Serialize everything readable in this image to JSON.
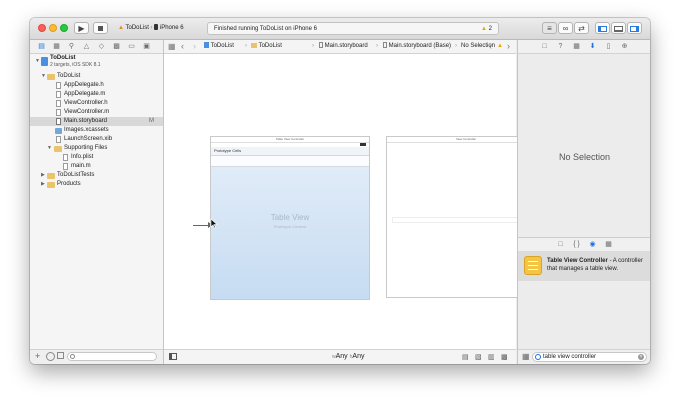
{
  "toolbar": {
    "scheme_app": "ToDoList",
    "scheme_device": "iPhone 6",
    "activity_status": "Finished running ToDoList on iPhone 6",
    "warning_count": "2"
  },
  "navigator": {
    "project_name": "ToDoList",
    "project_subtitle": "2 targets, iOS SDK 8.1",
    "items": [
      {
        "label": "ToDoList"
      },
      {
        "label": "AppDelegate.h"
      },
      {
        "label": "AppDelegate.m"
      },
      {
        "label": "ViewController.h"
      },
      {
        "label": "ViewController.m"
      },
      {
        "label": "Main.storyboard",
        "badge": "M"
      },
      {
        "label": "Images.xcassets"
      },
      {
        "label": "LaunchScreen.xib"
      },
      {
        "label": "Supporting Files"
      },
      {
        "label": "Info.plist"
      },
      {
        "label": "main.m"
      },
      {
        "label": "ToDoListTests"
      },
      {
        "label": "Products"
      }
    ]
  },
  "jumpbar": {
    "crumbs": [
      "ToDoList",
      "ToDoList",
      "Main.storyboard",
      "Main.storyboard (Base)",
      "No Selection"
    ]
  },
  "canvas": {
    "scene1_title": "Table View Controller",
    "prototype_cells": "Prototype Cells",
    "table_view_label": "Table View",
    "table_view_sub": "Prototype Content",
    "scene2_title": "View Controller"
  },
  "size_class": {
    "w_prefix": "w",
    "w_value": "Any",
    "h_prefix": "h",
    "h_value": "Any"
  },
  "inspector": {
    "no_selection": "No Selection",
    "library_item_title": "Table View Controller",
    "library_item_desc": " - A controller that manages a table view.",
    "filter_value": "table view controller"
  },
  "colors": {
    "accent": "#1a73e8",
    "folder": "#e9c46a",
    "close": "#fc5f57",
    "minimize": "#fdbc2e",
    "zoom": "#28c840",
    "table_bg_top": "#e4eef9",
    "table_bg_bottom": "#c6dcf2"
  }
}
